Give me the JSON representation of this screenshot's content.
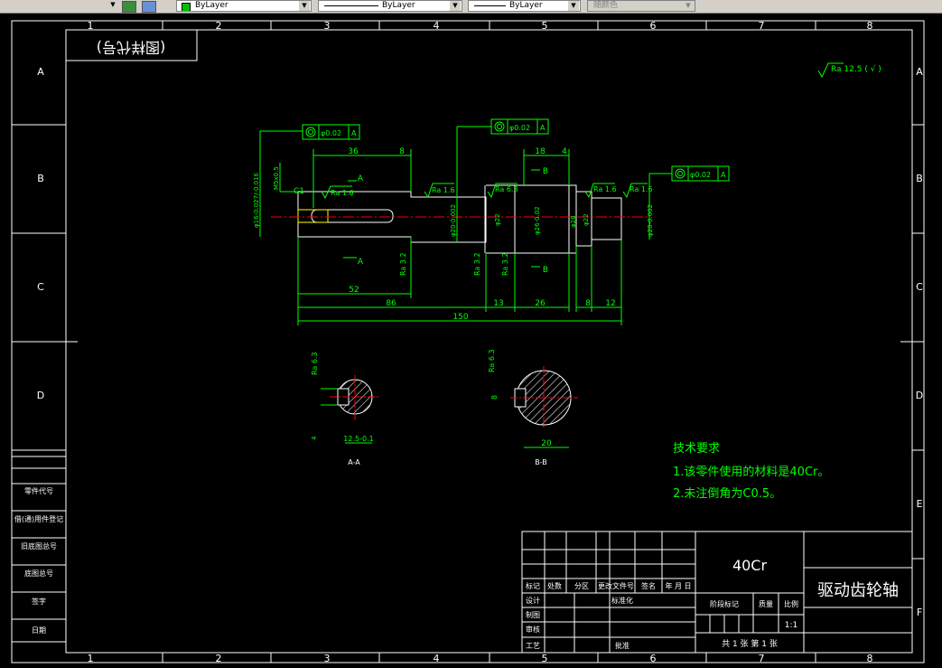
{
  "toolbar": {
    "color_label": "ByLayer",
    "linetype_label": "ByLayer",
    "lineweight_label": "ByLayer",
    "plotstyle_label": "随颜色",
    "color_swatch": "#00c000"
  },
  "border": {
    "cols": [
      "1",
      "2",
      "3",
      "4",
      "5",
      "6",
      "7",
      "8"
    ],
    "rows": [
      "A",
      "B",
      "C",
      "D",
      "E",
      "F"
    ]
  },
  "title_stamp": "(图样代号)",
  "roughness_general": "Ra 12.5 ( √ )",
  "datum": {
    "tol1": "φ0.02",
    "ref": "A",
    "ref_pos": "A"
  },
  "dims": {
    "d36": "36",
    "d8a": "8",
    "d18": "18",
    "d4": "4",
    "d52": "52",
    "d86": "86",
    "d150": "150",
    "d13": "13",
    "d26": "26",
    "d8b": "8",
    "d12": "12",
    "m5": "M5x0.5",
    "phi16": "φ16-0.027/-0.016",
    "phi20a": "φ20-0.002",
    "phi22a": "φ22",
    "phi26": "φ26-0.02",
    "phi28": "φ28",
    "phi22b": "φ22",
    "phi20b": "φ20-0.002",
    "sA_w": "12.5-0.1",
    "sA_h": "4",
    "sB_w": "20",
    "sB_h": "8",
    "ra16": "Ra 1.6",
    "ra63": "Ra 6.3",
    "ra32": "Ra 3.2",
    "secA": "A",
    "secB": "B",
    "c1": "C1"
  },
  "sections": {
    "a": "A-A",
    "b": "B-B"
  },
  "notes": {
    "title": "技术要求",
    "line1": "1.该零件使用的材料是40Cr。",
    "line2": "2.未注倒角为C0.5。"
  },
  "left_strip": [
    "零件代号",
    "借(通)用件登记",
    "旧底图总号",
    "底图总号",
    "签字",
    "日期"
  ],
  "title_block": {
    "material": "40Cr",
    "part_name": "驱动齿轮轴",
    "hdr": [
      "标记",
      "处数",
      "分区",
      "更改文件号",
      "签名",
      "年 月 日"
    ],
    "roles": [
      "设计",
      "制图",
      "审核",
      "工艺"
    ],
    "std": "标准化",
    "approve": "批准",
    "stage": "阶段标记",
    "weight": "质量",
    "scale": "比例",
    "scale_val": "1:1",
    "sheets": "共 1 张   第 1 张"
  }
}
